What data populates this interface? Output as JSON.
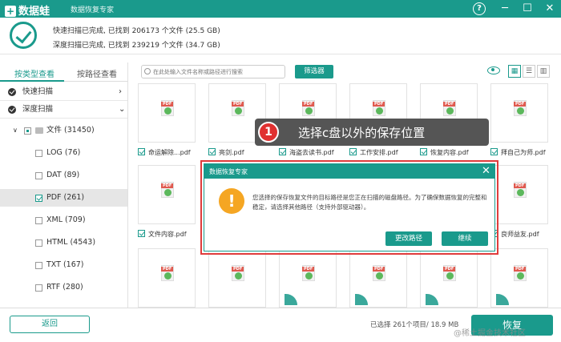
{
  "app": {
    "logo_text": "数据蛙",
    "window_title": "数据恢复专家",
    "help_label": "?",
    "minimize_label": "─",
    "maximize_label": "☐",
    "close_label": "✕"
  },
  "summary": {
    "quick_scan_text": "快速扫描已完成, 已找到 206173 个文件 (25.5 GB)",
    "deep_scan_text": "深度扫描已完成, 已找到 239219 个文件 (34.7 GB)"
  },
  "sidebar": {
    "tabs": [
      "按类型查看",
      "按路径查看"
    ],
    "quick_scan": "快速扫描",
    "deep_scan": "深度扫描",
    "tree": [
      {
        "label": "文件 (31450)"
      },
      {
        "label": "LOG (76)"
      },
      {
        "label": "DAT (89)"
      },
      {
        "label": "PDF (261)"
      },
      {
        "label": "XML (709)"
      },
      {
        "label": "HTML (4543)"
      },
      {
        "label": "TXT (167)"
      },
      {
        "label": "RTF (280)"
      }
    ]
  },
  "toolbar": {
    "search_placeholder": "在此处输入文件名称或路径进行搜索",
    "filter_label": "筛选器"
  },
  "grid": {
    "row1": [
      "命运解除...pdf",
      "亮剑.pdf",
      "海盗去读书.pdf",
      "工作安排.pdf",
      "恢复内容.pdf",
      "拜自己为师.pdf"
    ],
    "row2_first": "文件内容.pdf",
    "row2_last": "良师益友.pdf"
  },
  "callout": {
    "number": "1",
    "text": "选择c盘以外的保存位置"
  },
  "dialog": {
    "title": "数据恢复专家",
    "close_label": "✕",
    "icon": "!",
    "message": "您选择的保存恢复文件的目标路径是您正在扫描的磁盘路径。为了确保数据恢复的完整和稳定，请选择其他路径（支持外部驱动器）。",
    "change_path_label": "更改路径",
    "continue_label": "继续"
  },
  "footer": {
    "back_label": "返回",
    "selection_status": "已选择 261个项目/ 18.9 MB",
    "recover_label": "恢复",
    "watermark": "@稀土掘金技术社区"
  },
  "colors": {
    "accent": "#1a9a8c",
    "alert_border": "#e03c3c",
    "warning": "#f5a623",
    "callout_badge": "#e03030"
  }
}
